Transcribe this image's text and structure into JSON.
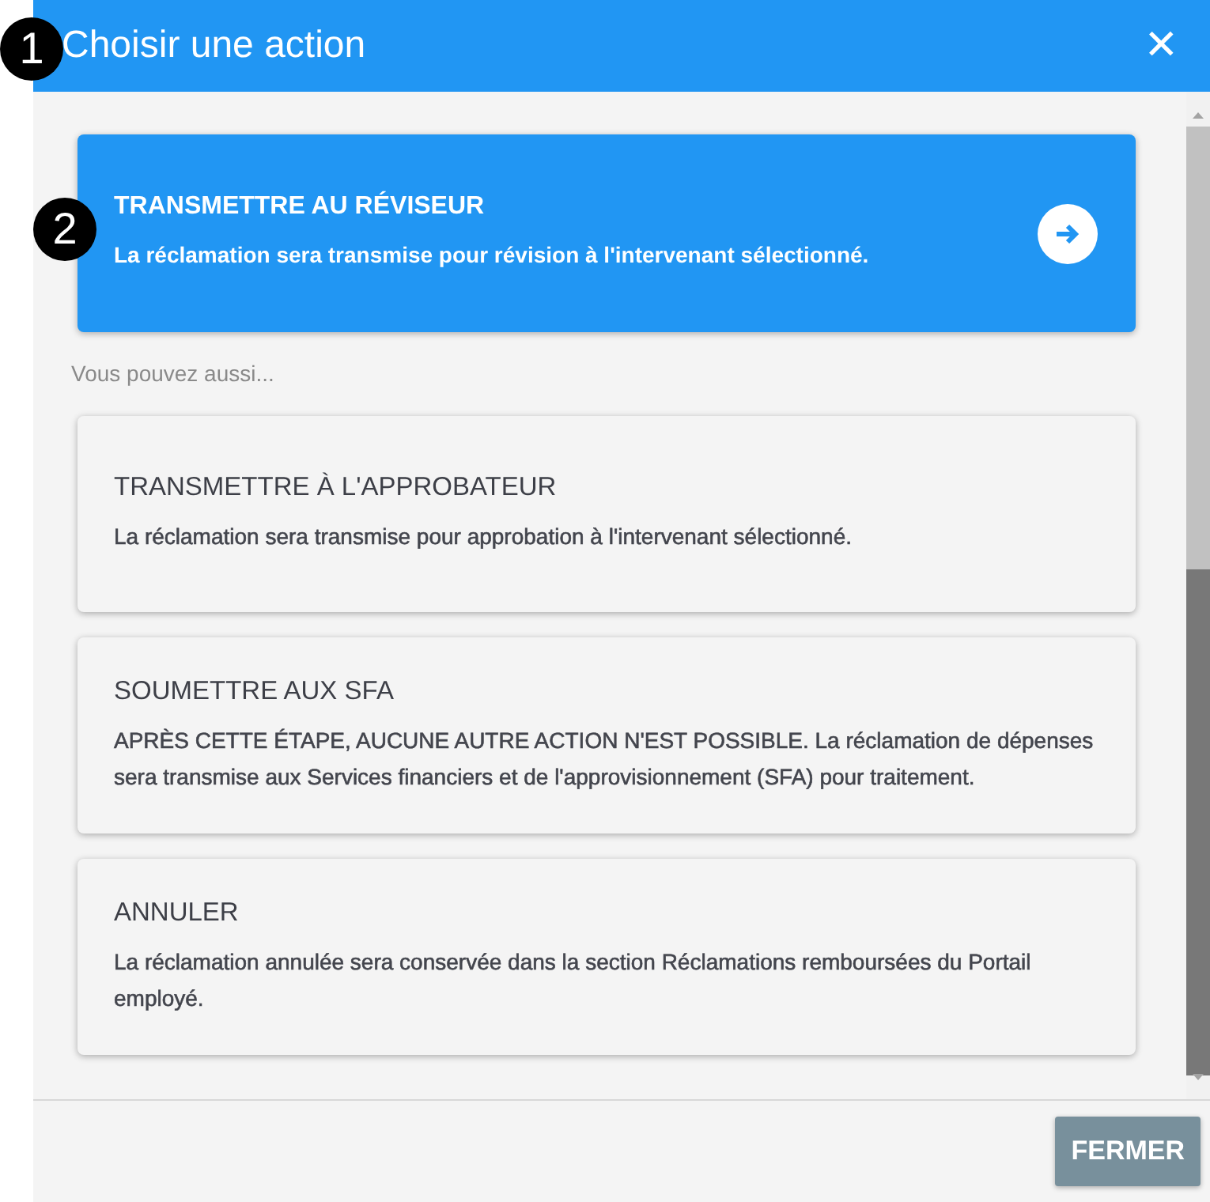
{
  "dialog": {
    "title": "Choisir une action",
    "close_icon": "✕"
  },
  "primary_action": {
    "title": "TRANSMETTRE AU RÉVISEUR",
    "description": "La réclamation sera transmise pour révision à l'intervenant sélectionné."
  },
  "hint": "Vous pouvez aussi...",
  "actions": [
    {
      "title": "TRANSMETTRE À L'APPROBATEUR",
      "description": "La réclamation sera transmise pour approbation à l'intervenant sélectionné."
    },
    {
      "title": "SOUMETTRE AUX SFA",
      "description": "APRÈS CETTE ÉTAPE, AUCUNE AUTRE ACTION N'EST POSSIBLE. La réclamation de dépenses sera transmise aux Services financiers et de l'approvisionnement (SFA) pour traitement."
    },
    {
      "title": "ANNULER",
      "description": "La réclamation annulée sera conservée dans la section Réclamations remboursées du Portail employé."
    }
  ],
  "footer": {
    "button": "FERMER"
  },
  "callouts": [
    "1",
    "2"
  ]
}
